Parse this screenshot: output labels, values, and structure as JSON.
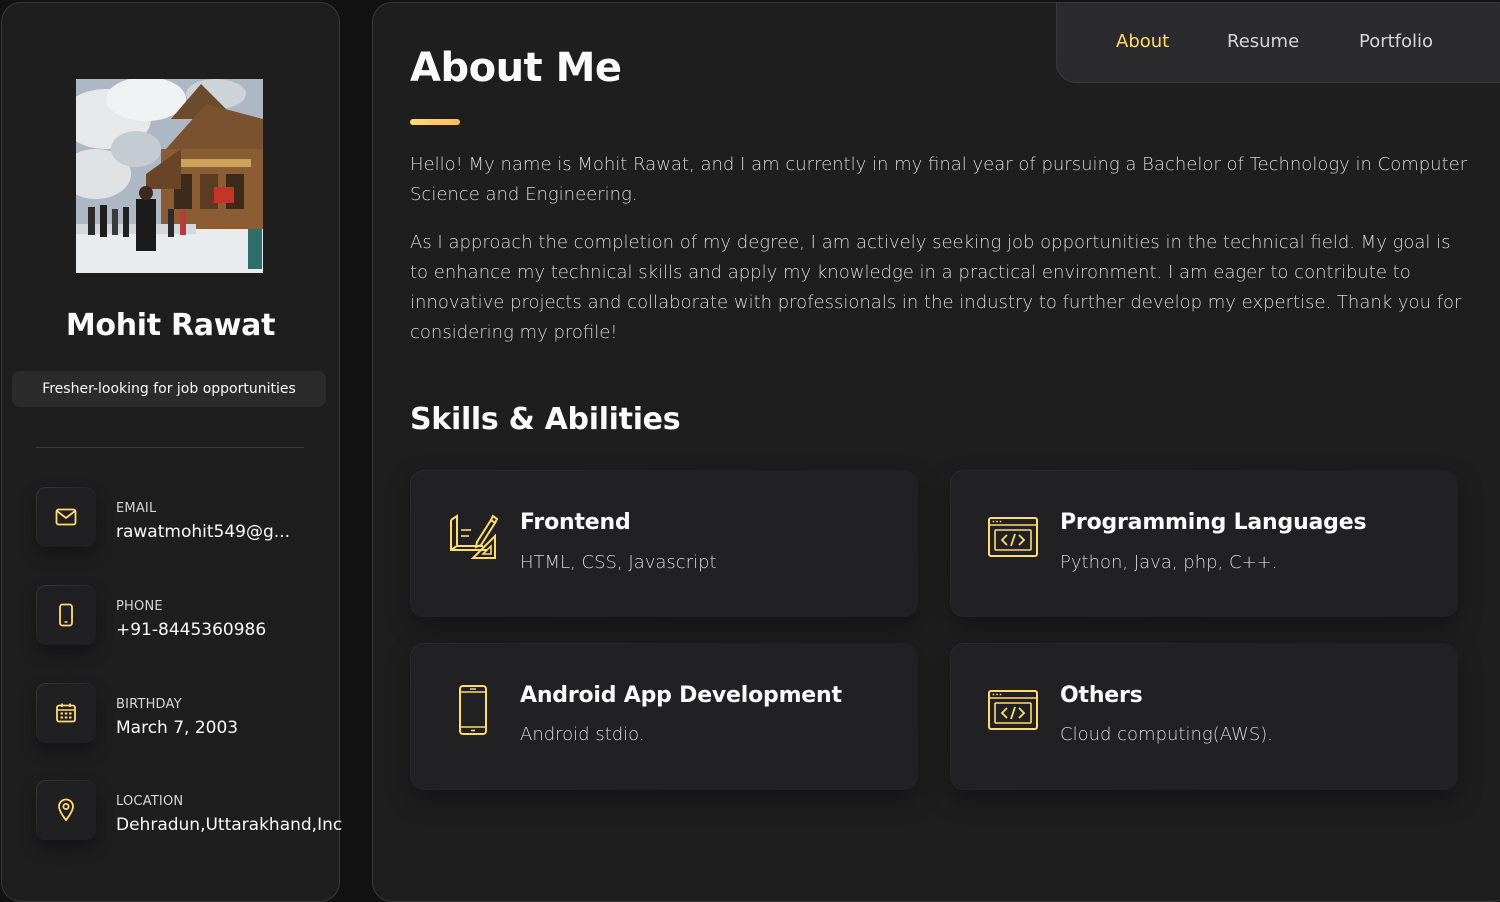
{
  "sidebar": {
    "name": "Mohit Rawat",
    "title": "Fresher-looking for job opportunities",
    "contacts": [
      {
        "label": "Email",
        "value": "rawatmohit549@g...",
        "icon": "mail-icon"
      },
      {
        "label": "Phone",
        "value": "+91-8445360986",
        "icon": "phone-icon"
      },
      {
        "label": "Birthday",
        "value": "March 7, 2003",
        "icon": "calendar-icon"
      },
      {
        "label": "Location",
        "value": "Dehradun,Uttarakhand,Inc",
        "icon": "location-icon"
      }
    ]
  },
  "navbar": {
    "links": [
      "About",
      "Resume",
      "Portfolio"
    ],
    "active": "About"
  },
  "about": {
    "title": "About Me",
    "paragraphs": [
      "Hello! My name is Mohit Rawat, and I am currently in my final year of pursuing a Bachelor of Technology in Computer Science and Engineering.",
      "As I approach the completion of my degree, I am actively seeking job opportunities in the technical field. My goal is to enhance my technical skills and apply my knowledge in a practical environment. I am eager to contribute to innovative projects and collaborate with professionals in the industry to further develop my expertise. Thank you for considering my profile!"
    ]
  },
  "skills": {
    "title": "Skills & Abilities",
    "cards": [
      {
        "title": "Frontend",
        "text": "HTML, CSS, Javascript",
        "icon": "design-icon"
      },
      {
        "title": "Programming Languages",
        "text": "Python, Java, php, C++.",
        "icon": "code-window-icon"
      },
      {
        "title": "Android App Development",
        "text": "Android stdio.",
        "icon": "mobile-icon"
      },
      {
        "title": "Others",
        "text": "Cloud computing(AWS).",
        "icon": "code-window-icon"
      }
    ]
  },
  "colors": {
    "accent": "#ffdb70",
    "background": "#121212",
    "panel": "#1e1e1f"
  }
}
